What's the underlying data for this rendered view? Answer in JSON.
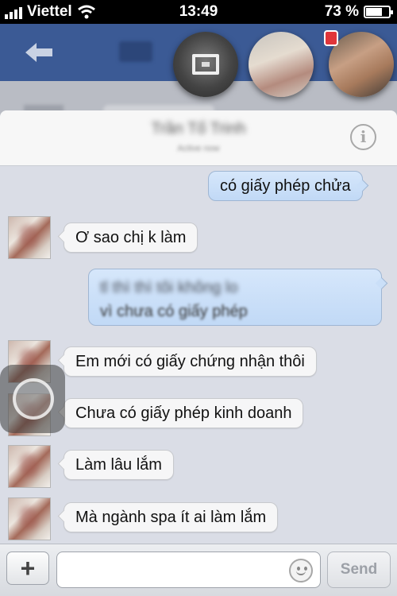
{
  "status_bar": {
    "carrier": "Viettel",
    "time": "13:49",
    "battery_percent": "73 %",
    "battery_level": 0.73,
    "signal_bars": 4
  },
  "conversation": {
    "contact_name": "Trần Tố Trinh",
    "contact_status": "Active now",
    "messages": [
      {
        "direction": "out",
        "text": "có giấy phép chửa"
      },
      {
        "direction": "in",
        "text": "Ơ sao chị k làm"
      },
      {
        "direction": "out",
        "text": "vì chưa có giấy phép",
        "blurred_prefix": "tl thì thì tôi không lo"
      },
      {
        "direction": "in",
        "text": "Em mới có giấy chứng nhận thôi"
      },
      {
        "direction": "in",
        "text": "Chưa có giấy phép kinh doanh"
      },
      {
        "direction": "in",
        "text": "Làm lâu lắm"
      },
      {
        "direction": "in",
        "text": "Mà ngành spa ít ai làm lắm"
      }
    ]
  },
  "composer": {
    "input_value": "",
    "input_placeholder": "",
    "send_label": "Send",
    "plus_label": "+"
  },
  "icons": [
    "wifi-icon",
    "back-arrow-icon",
    "info-icon",
    "emoji-icon",
    "plus-icon",
    "assistive-touch-icon"
  ],
  "colors": {
    "facebook_blue": "#3b5a95",
    "outgoing_bubble": "#c9ddf7",
    "incoming_bubble": "#f6f6f7",
    "chat_background": "#dadde6"
  }
}
